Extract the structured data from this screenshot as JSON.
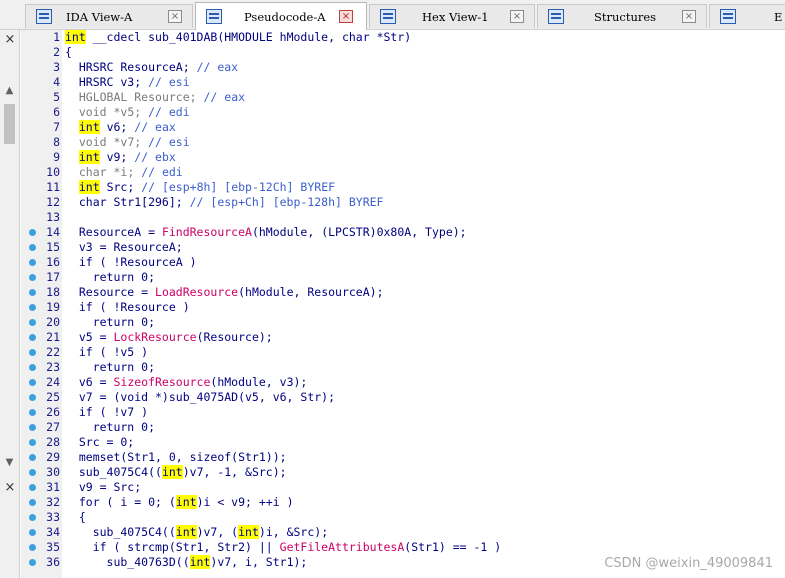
{
  "tabs": [
    {
      "label": "IDA View-A",
      "icon": "disassembly-view-icon",
      "active": false
    },
    {
      "label": "Pseudocode-A",
      "icon": "pseudocode-view-icon",
      "active": true
    },
    {
      "label": "Hex View-1",
      "icon": "hex-view-icon",
      "active": false
    },
    {
      "label": "Structures",
      "icon": "structures-icon",
      "active": false
    },
    {
      "label": "E",
      "icon": "enums-icon",
      "active": false
    }
  ],
  "close_glyph": "×",
  "left_panel": {
    "close_glyph": "×",
    "scroll_up": "▲",
    "scroll_down": "▼"
  },
  "gutter": {
    "line_numbers": [
      "1",
      "2",
      "3",
      "4",
      "5",
      "6",
      "7",
      "8",
      "9",
      "10",
      "11",
      "12",
      "13",
      "14",
      "15",
      "16",
      "17",
      "18",
      "19",
      "20",
      "21",
      "22",
      "23",
      "24",
      "25",
      "26",
      "27",
      "28",
      "29",
      "30",
      "31",
      "32",
      "33",
      "34",
      "35",
      "36"
    ],
    "breakpoint_lines_from": 14
  },
  "code_lines": [
    "int __cdecl sub_401DAB(HMODULE hModule, char *Str)",
    "{",
    "  HRSRC ResourceA; // eax",
    "  HRSRC v3; // esi",
    "  HGLOBAL Resource; // eax",
    "  void *v5; // edi",
    "  int v6; // eax",
    "  void *v7; // esi",
    "  int v9; // ebx",
    "  char *i; // edi",
    "  int Src; // [esp+8h] [ebp-12Ch] BYREF",
    "  char Str1[296]; // [esp+Ch] [ebp-128h] BYREF",
    "",
    "  ResourceA = FindResourceA(hModule, (LPCSTR)0x80A, Type);",
    "  v3 = ResourceA;",
    "  if ( !ResourceA )",
    "    return 0;",
    "  Resource = LoadResource(hModule, ResourceA);",
    "  if ( !Resource )",
    "    return 0;",
    "  v5 = LockResource(Resource);",
    "  if ( !v5 )",
    "    return 0;",
    "  v6 = SizeofResource(hModule, v3);",
    "  v7 = (void *)sub_4075AD(v5, v6, Str);",
    "  if ( !v7 )",
    "    return 0;",
    "  Src = 0;",
    "  memset(Str1, 0, sizeof(Str1));",
    "  sub_4075C4((int)v7, -1, &Src);",
    "  v9 = Src;",
    "  for ( i = 0; (int)i < v9; ++i )",
    "  {",
    "    sub_4075C4((int)v7, (int)i, &Src);",
    "    if ( strcmp(Str1, Str2) || GetFileAttributesA(Str1) == -1 )",
    "      sub_40763D((int)v7, i, Str1);"
  ],
  "watermark": "CSDN @weixin_49009841",
  "colors": {
    "keyword_highlight": "#ffff00",
    "comment": "#3a5fcd",
    "function": "#cc0066",
    "identifier": "#000080",
    "breakpoint_dot": "#3aa0e0"
  }
}
